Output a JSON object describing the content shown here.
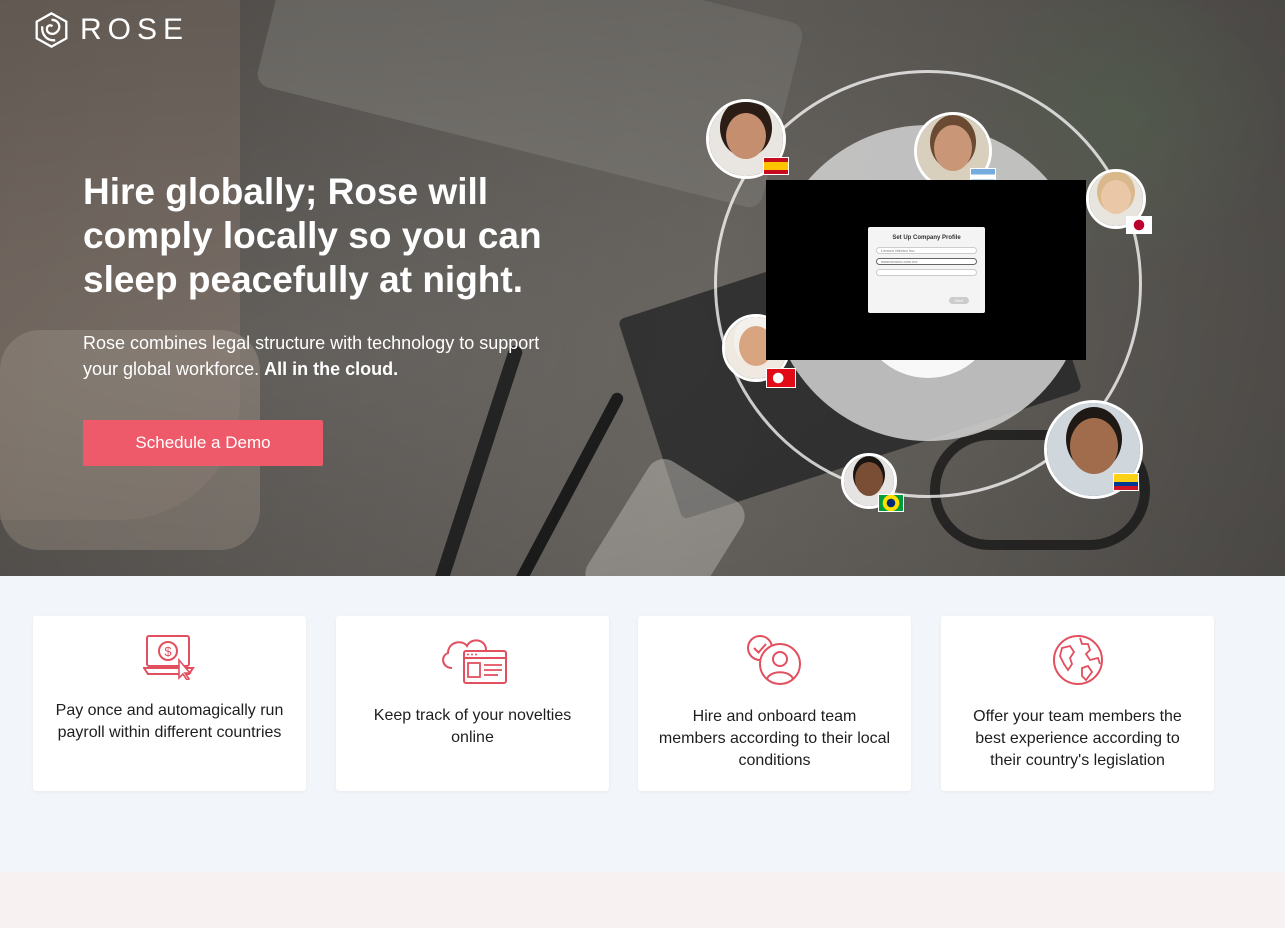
{
  "brand": {
    "name": "ROSE"
  },
  "hero": {
    "headline": "Hire globally; Rose will comply locally so you can sleep peacefully at night.",
    "subtext_plain": "Rose combines legal structure with technology to support your global workforce.",
    "subtext_bold": "All in the cloud.",
    "cta_label": "Schedule a Demo"
  },
  "video": {
    "card_title": "Set Up Company Profile",
    "field_1": "Lenovo Mexico Inc.",
    "field_2": "www.lenovo.com.mx",
    "field_3": "",
    "button_label": "Next"
  },
  "avatars": [
    {
      "name": "avatar-spain",
      "flag": "spain-flag"
    },
    {
      "name": "avatar-argentina",
      "flag": "argentina-flag"
    },
    {
      "name": "avatar-japan",
      "flag": "japan-flag"
    },
    {
      "name": "avatar-turkey",
      "flag": "turkey-flag"
    },
    {
      "name": "avatar-colombia",
      "flag": "colombia-flag"
    },
    {
      "name": "avatar-brazil",
      "flag": "brazil-flag"
    }
  ],
  "features": [
    {
      "icon": "payroll-laptop-icon",
      "text": "Pay once and automagically run payroll within different countries"
    },
    {
      "icon": "cloud-document-icon",
      "text": "Keep track of your novelties online"
    },
    {
      "icon": "user-check-icon",
      "text": "Hire and onboard team members according to their local conditions"
    },
    {
      "icon": "globe-icon",
      "text": "Offer your team members the best experience according to their country's legislation"
    }
  ],
  "colors": {
    "accent": "#ef5a6b",
    "icon": "#e2505f",
    "features_bg": "#f2f5f9",
    "footer_bg": "#f7f1f1"
  }
}
